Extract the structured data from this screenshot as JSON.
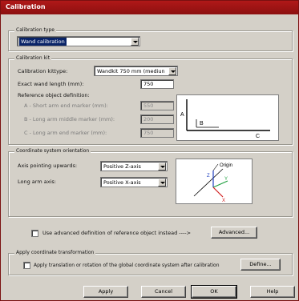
{
  "window": {
    "title": "Calibration"
  },
  "calibration_type": {
    "legend": "Calibration type",
    "value": "Wand calibration"
  },
  "calibration_kit": {
    "legend": "Calibration kit",
    "kittype_label": "Calibration kittype:",
    "kittype_value": "Wandkit 750 mm (mediun",
    "wand_length_label": "Exact wand length (mm):",
    "wand_length_value": "750",
    "ref_object_label": "Reference object definition:",
    "short_arm_label": "A - Short arm end marker (mm):",
    "short_arm_value": "550",
    "long_arm_mid_label": "B - Long arm middle marker (mm):",
    "long_arm_mid_value": "200",
    "long_arm_end_label": "C - Long arm end marker (mm):",
    "long_arm_end_value": "750",
    "diagram": {
      "a": "A",
      "b": "B",
      "c": "C"
    }
  },
  "orientation": {
    "legend": "Coordinate system orientation",
    "axis_up_label": "Axis pointing upwards:",
    "axis_up_value": "Positive Z-axis",
    "long_arm_axis_label": "Long arm axis:",
    "long_arm_axis_value": "Positive X-axis",
    "diagram": {
      "origin": "Origin",
      "z": "Z",
      "y": "Y",
      "x": "X"
    }
  },
  "advanced": {
    "checkbox_label": "Use advanced definition of reference object instead ---->",
    "button_label": "Advanced..."
  },
  "transform": {
    "legend": "Apply coordinate transformation",
    "checkbox_label": "Apply translation or rotation of the global coordinate system after calibration",
    "button_label": "Define..."
  },
  "footer": {
    "apply": "Apply",
    "cancel": "Cancel",
    "ok": "OK",
    "help": "Help"
  },
  "colors": {
    "title_bar": "#a01414",
    "face": "#d4d0c8",
    "selection": "#0a2468"
  }
}
